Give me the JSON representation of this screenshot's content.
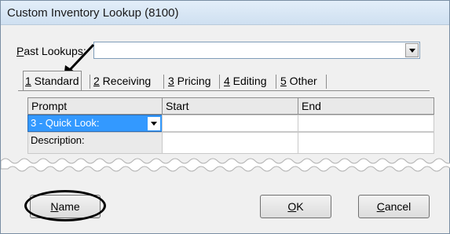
{
  "window": {
    "title": "Custom Inventory Lookup (8100)"
  },
  "past_lookups": {
    "label_key": "P",
    "label_rest": "ast Lookups:",
    "value": ""
  },
  "tabs": [
    {
      "key": "1",
      "label": " Standard"
    },
    {
      "key": "2",
      "label": " Receiving"
    },
    {
      "key": "3",
      "label": " Pricing"
    },
    {
      "key": "4",
      "label": " Editing"
    },
    {
      "key": "5",
      "label": " Other"
    }
  ],
  "grid": {
    "headers": [
      "Prompt",
      "Start",
      "End"
    ],
    "rows": [
      {
        "prompt": "3 - Quick Look:",
        "start": "",
        "end": ""
      },
      {
        "prompt": "Description:",
        "start": "",
        "end": ""
      }
    ]
  },
  "buttons": {
    "name": {
      "key": "N",
      "rest": "ame"
    },
    "ok": {
      "key": "O",
      "rest": "K"
    },
    "cancel": {
      "key": "C",
      "rest": "ancel"
    }
  }
}
